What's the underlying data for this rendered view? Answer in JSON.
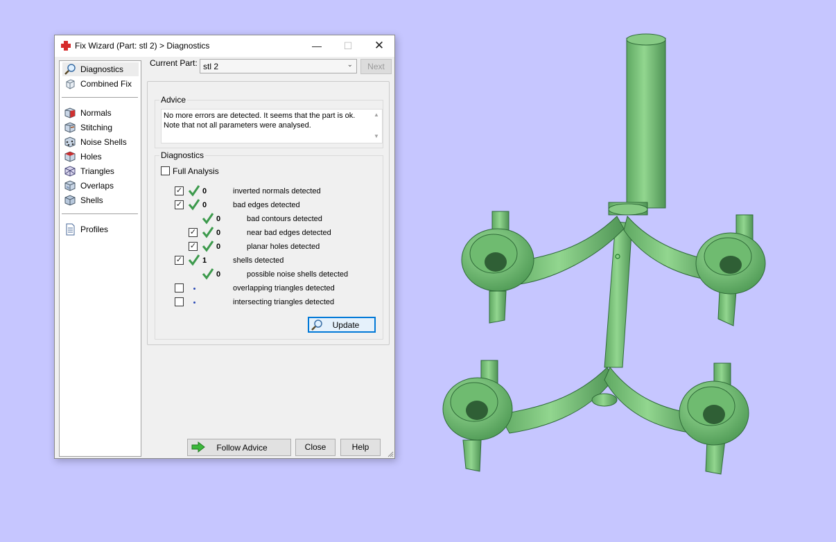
{
  "window": {
    "title": "Fix Wizard (Part: stl 2) > Diagnostics",
    "controls": {
      "minimize": "—",
      "maximize": "☐",
      "close": "✕"
    }
  },
  "sidebar": {
    "group1": [
      {
        "label": "Diagnostics",
        "icon": "magnifier-icon",
        "selected": true
      },
      {
        "label": "Combined Fix",
        "icon": "cube-icon"
      }
    ],
    "group2": [
      {
        "label": "Normals",
        "icon": "normals-cube-icon"
      },
      {
        "label": "Stitching",
        "icon": "stitching-cube-icon"
      },
      {
        "label": "Noise Shells",
        "icon": "noise-shells-cube-icon"
      },
      {
        "label": "Holes",
        "icon": "holes-cube-icon"
      },
      {
        "label": "Triangles",
        "icon": "triangles-cube-icon"
      },
      {
        "label": "Overlaps",
        "icon": "overlaps-cube-icon"
      },
      {
        "label": "Shells",
        "icon": "shells-cube-icon"
      }
    ],
    "group3": [
      {
        "label": "Profiles",
        "icon": "document-icon"
      }
    ]
  },
  "current_part": {
    "label": "Current Part:",
    "value": "stl 2",
    "next": "Next"
  },
  "advice": {
    "legend": "Advice",
    "line1": "No more errors are detected. It seems that the part is ok.",
    "line2": "Note that not all parameters were analysed."
  },
  "diagnostics": {
    "legend": "Diagnostics",
    "full_analysis": "Full Analysis",
    "rows": [
      {
        "checkbox": true,
        "checked": true,
        "status": "ok",
        "count": "0",
        "label": "inverted normals detected",
        "indent": 0
      },
      {
        "checkbox": true,
        "checked": true,
        "status": "ok",
        "count": "0",
        "label": "bad edges detected",
        "indent": 0
      },
      {
        "checkbox": false,
        "checked": false,
        "status": "ok",
        "count": "0",
        "label": "bad contours detected",
        "indent": 1
      },
      {
        "checkbox": true,
        "checked": true,
        "status": "ok",
        "count": "0",
        "label": "near bad edges detected",
        "indent": 1
      },
      {
        "checkbox": true,
        "checked": true,
        "status": "ok",
        "count": "0",
        "label": "planar holes detected",
        "indent": 1
      },
      {
        "checkbox": true,
        "checked": true,
        "status": "ok",
        "count": "1",
        "label": "shells detected",
        "indent": 0
      },
      {
        "checkbox": false,
        "checked": false,
        "status": "ok",
        "count": "0",
        "label": "possible noise shells detected",
        "indent": 1
      },
      {
        "checkbox": true,
        "checked": false,
        "status": "pending",
        "count": "",
        "label": "overlapping triangles detected",
        "indent": 0
      },
      {
        "checkbox": true,
        "checked": false,
        "status": "pending",
        "count": "",
        "label": "intersecting triangles detected",
        "indent": 0
      }
    ],
    "update": "Update"
  },
  "footer": {
    "follow_advice": "Follow Advice",
    "close": "Close",
    "help": "Help"
  },
  "colors": {
    "background": "#c6c6ff",
    "model_fill": "#7cc47c",
    "model_shadow": "#4f9a55",
    "check_green": "#3c9a4c",
    "focus_blue": "#0078d7"
  }
}
